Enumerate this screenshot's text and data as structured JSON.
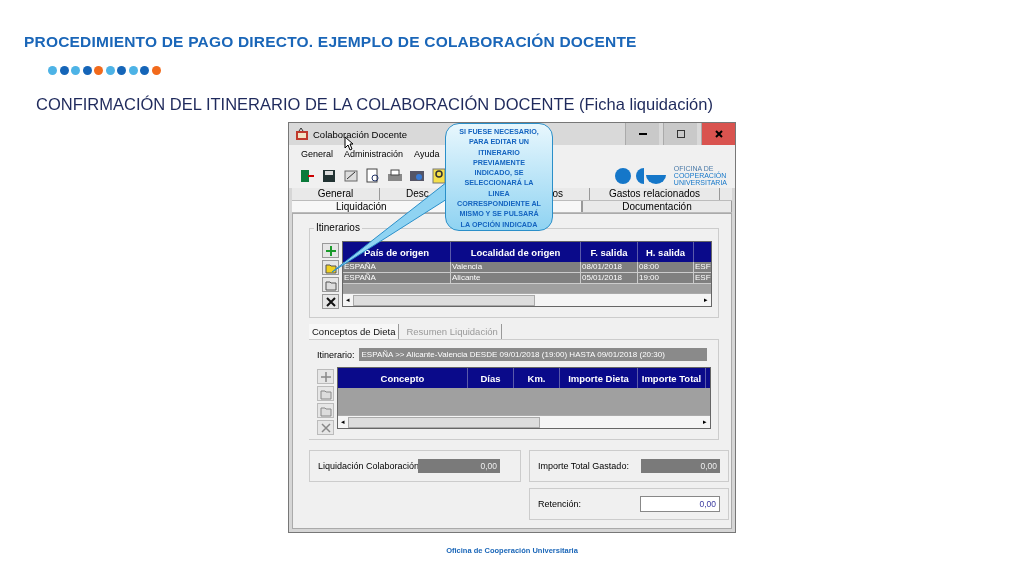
{
  "slide": {
    "title": "PROCEDIMIENTO DE PAGO DIRECTO. EJEMPLO DE COLABORACIÓN DOCENTE",
    "dots": [
      {
        "color": "#4db3e6"
      },
      {
        "color": "#1565b8"
      },
      {
        "color": "#4db3e6"
      },
      {
        "color": "#1565b8"
      },
      {
        "color": "#f26a1b"
      },
      {
        "color": "#4db3e6"
      },
      {
        "color": "#1565b8"
      },
      {
        "color": "#4db3e6"
      },
      {
        "color": "#1565b8"
      },
      {
        "color": "#f26a1b"
      }
    ],
    "subtitle": "CONFIRMACIÓN DEL ITINERARIO DE LA COLABORACIÓN DOCENTE (Ficha liquidación)",
    "footer": "Oficina de Cooperación Universitaria"
  },
  "window": {
    "title": "Colaboración Docente",
    "menu": [
      "General",
      "Administración",
      "Ayuda"
    ],
    "logo": {
      "lines": [
        "OFICINA DE",
        "COOPERACIÓN",
        "UNIVERSITARIA"
      ]
    },
    "tabs_row_1": [
      {
        "label": "General",
        "selected": false
      },
      {
        "label": "Desc",
        "selected": false
      },
      {
        "label": "os",
        "selected": false
      },
      {
        "label": "Gastos relacionados",
        "selected": false
      }
    ],
    "tabs_row_2": [
      {
        "label": "Liquidación",
        "selected": true
      },
      {
        "label": "Documentación",
        "selected": false
      }
    ],
    "itinerarios": {
      "title": "Itinerarios",
      "columns": [
        "País de origen",
        "Localidad de origen",
        "F. salida",
        "H. salida"
      ],
      "rows": [
        [
          "ESPAÑA",
          "Valencia",
          "08/01/2018",
          "08:00",
          "ESF"
        ],
        [
          "ESPAÑA",
          "Alicante",
          "05/01/2018",
          "19:00",
          "ESF"
        ]
      ]
    },
    "scroll_arrows": [
      "◂",
      "▸",
      "◂",
      "▸"
    ],
    "sub_tabs": [
      {
        "label": "Conceptos de Dieta",
        "selected": true
      },
      {
        "label": "Resumen Liquidación",
        "selected": false
      }
    ],
    "itinerario": {
      "label": "Itinerario:",
      "value": "ESPAÑA >> Alicante-Valencia DESDE 09/01/2018 (19:00) HASTA 09/01/2018 (20:30)"
    },
    "conceptos": {
      "columns": [
        "Concepto",
        "Días",
        "Km.",
        "Importe Dieta",
        "Importe Total"
      ]
    },
    "totals": [
      {
        "label": "Liquidación Colaboración",
        "value": "0,00",
        "editable": false
      },
      {
        "label": "Importe Total Gastado:",
        "value": "0,00",
        "editable": false
      },
      {
        "label": "Retención:",
        "value": "0,00",
        "editable": true
      }
    ]
  },
  "callout": {
    "text": "SI FUESE NECESARIO, PARA EDITAR UN ITINERARIO PREVIAMENTE INDICADO, SE SELECCIONARÁ LA LINEA CORRESPONDIENTE AL MISMO Y SE PULSARÁ LA OPCIÓN INDICADA"
  }
}
